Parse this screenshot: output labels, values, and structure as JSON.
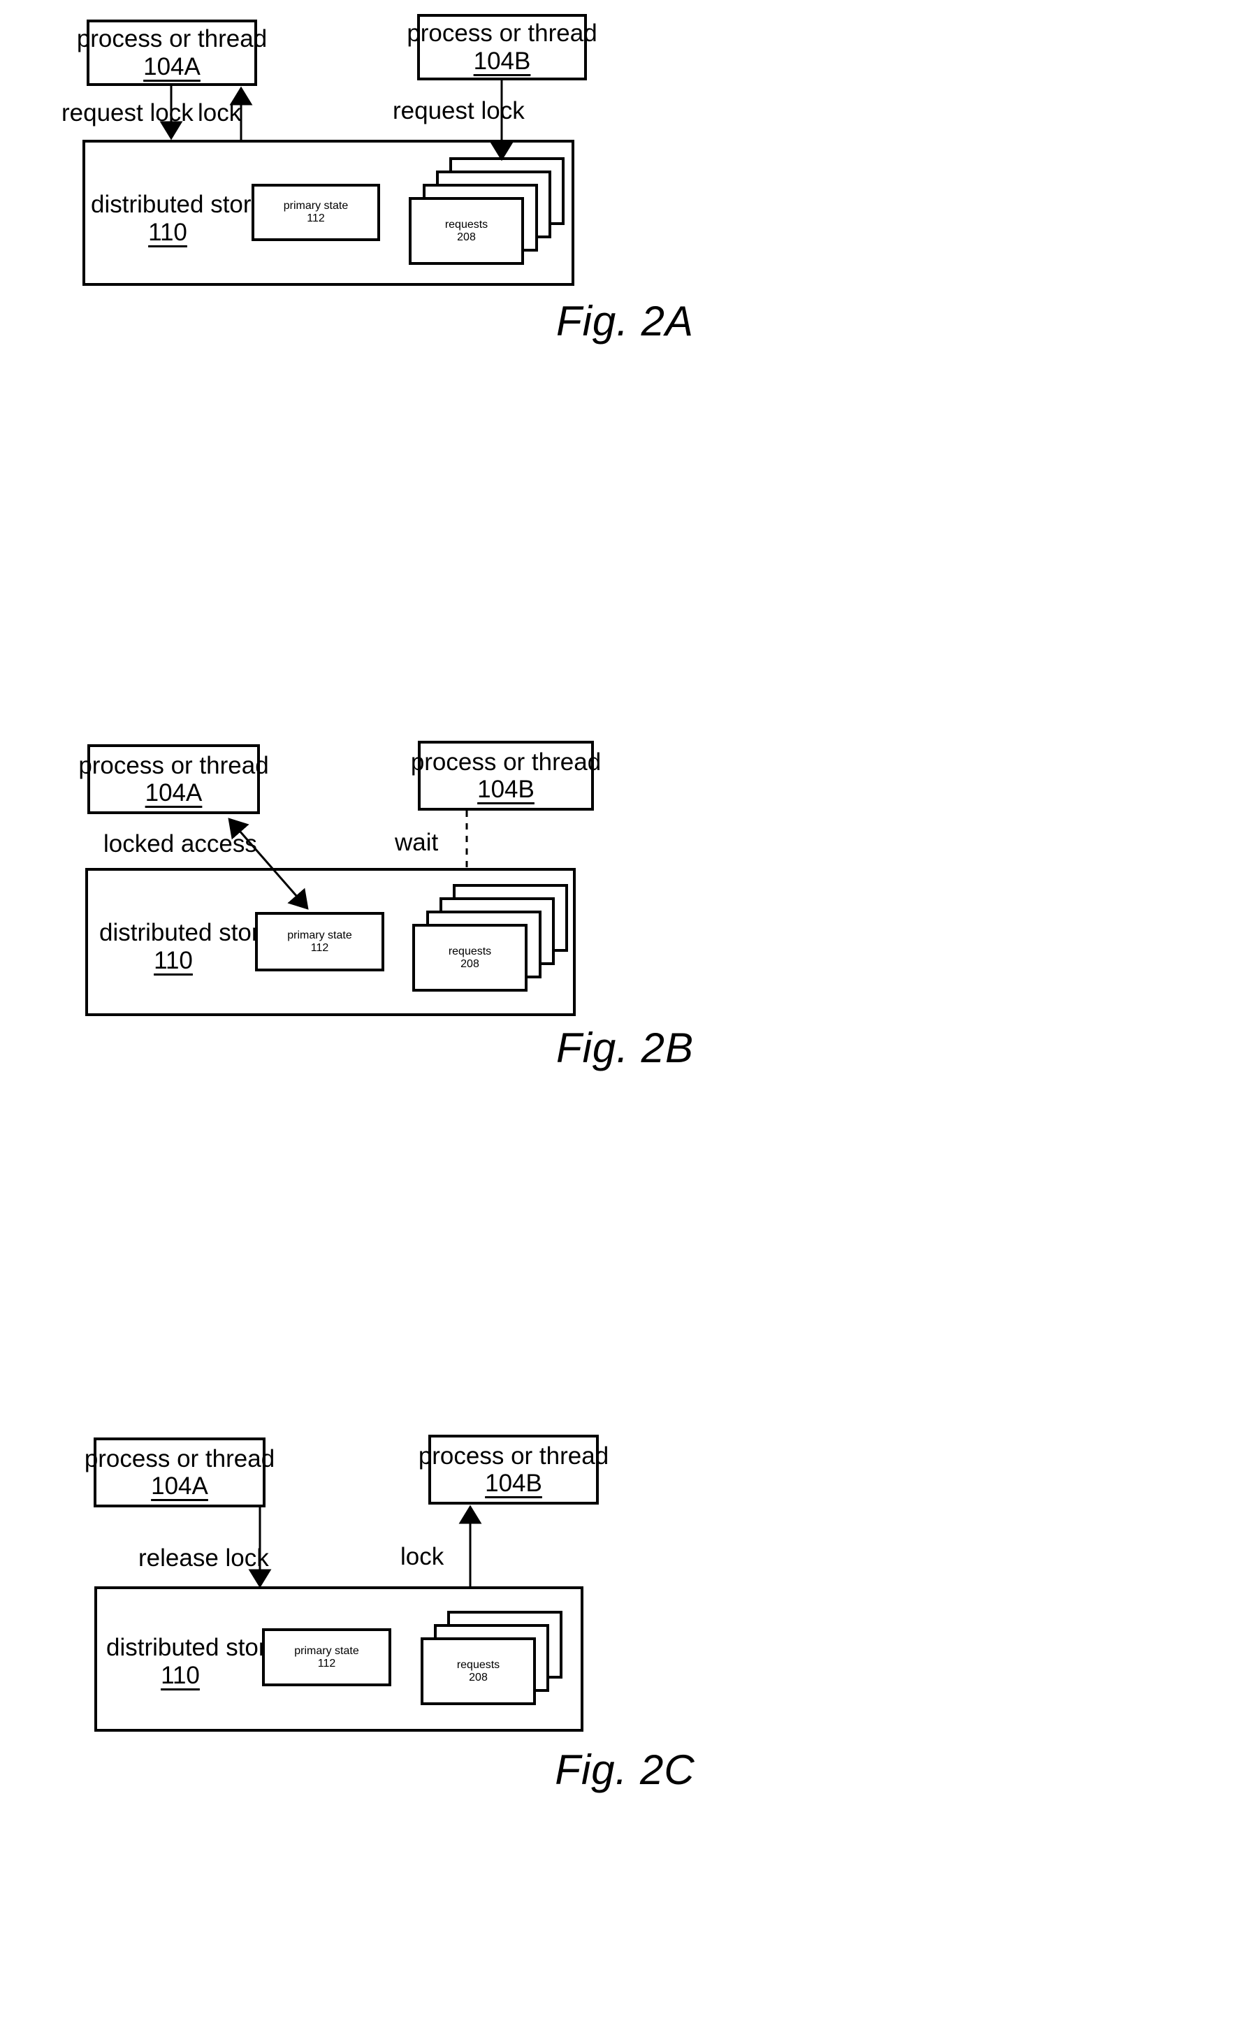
{
  "document": {
    "type": "patent-figure-sheet",
    "figures": [
      {
        "id": "fig-2a",
        "caption": "Fig. 2A",
        "nodes": {
          "process_a": {
            "title": "process or thread",
            "ref": "104A"
          },
          "process_b": {
            "title": "process or thread",
            "ref": "104B"
          },
          "store": {
            "title": "distributed store",
            "ref": "110"
          },
          "primary_state": {
            "title": "primary state",
            "ref": "112"
          },
          "requests": {
            "title": "requests",
            "ref": "208",
            "card_count": 4
          }
        },
        "edges": [
          {
            "label": "request lock",
            "from": "process_a",
            "to": "store",
            "style": "solid",
            "arrow": "end"
          },
          {
            "label": "lock",
            "from": "store",
            "to": "process_a",
            "style": "solid",
            "arrow": "end"
          },
          {
            "label": "request lock",
            "from": "process_b",
            "to": "requests",
            "style": "solid",
            "arrow": "end"
          }
        ]
      },
      {
        "id": "fig-2b",
        "caption": "Fig. 2B",
        "nodes": {
          "process_a": {
            "title": "process or thread",
            "ref": "104A"
          },
          "process_b": {
            "title": "process or thread",
            "ref": "104B"
          },
          "store": {
            "title": "distributed store",
            "ref": "110"
          },
          "primary_state": {
            "title": "primary state",
            "ref": "112"
          },
          "requests": {
            "title": "requests",
            "ref": "208",
            "card_count": 4
          }
        },
        "edges": [
          {
            "label": "locked access",
            "from": "process_a",
            "to": "primary_state",
            "style": "solid",
            "arrow": "both"
          },
          {
            "label": "wait",
            "from": "process_b",
            "to": "store",
            "style": "dashed",
            "arrow": "none"
          }
        ]
      },
      {
        "id": "fig-2c",
        "caption": "Fig. 2C",
        "nodes": {
          "process_a": {
            "title": "process or thread",
            "ref": "104A"
          },
          "process_b": {
            "title": "process or thread",
            "ref": "104B"
          },
          "store": {
            "title": "distributed store",
            "ref": "110"
          },
          "primary_state": {
            "title": "primary state",
            "ref": "112"
          },
          "requests": {
            "title": "requests",
            "ref": "208",
            "card_count": 3
          }
        },
        "edges": [
          {
            "label": "release lock",
            "from": "process_a",
            "to": "store",
            "style": "solid",
            "arrow": "end"
          },
          {
            "label": "lock",
            "from": "store",
            "to": "process_b",
            "style": "solid",
            "arrow": "end"
          }
        ]
      }
    ],
    "colors": {
      "ink": "#000000",
      "paper": "#ffffff"
    }
  }
}
